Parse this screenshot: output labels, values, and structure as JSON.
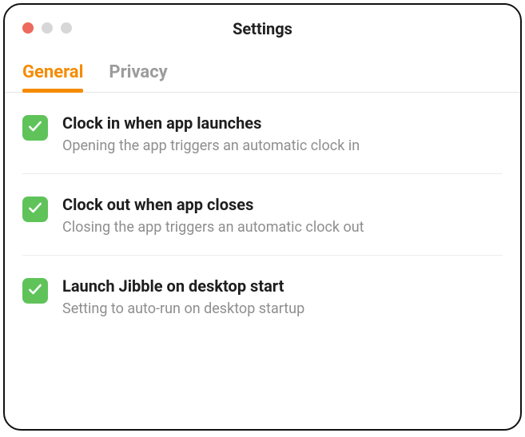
{
  "window": {
    "title": "Settings"
  },
  "tabs": {
    "general": "General",
    "privacy": "Privacy",
    "active": "general"
  },
  "options": [
    {
      "checked": true,
      "title": "Clock in when app launches",
      "desc": "Opening the app triggers an automatic clock in"
    },
    {
      "checked": true,
      "title": "Clock out when app closes",
      "desc": "Closing the app triggers an automatic clock out"
    },
    {
      "checked": true,
      "title": "Launch Jibble on desktop start",
      "desc": "Setting to auto-run on desktop startup"
    }
  ],
  "colors": {
    "accent": "#f58b00",
    "checkbox": "#5fc35a",
    "close_btn": "#ed6a5e"
  }
}
